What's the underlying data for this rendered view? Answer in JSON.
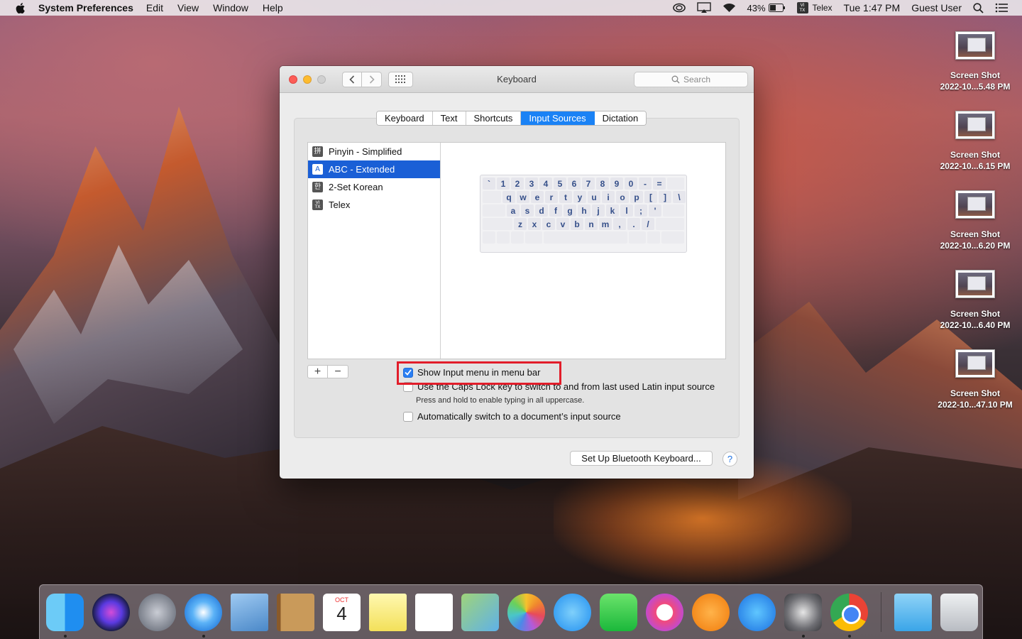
{
  "menubar": {
    "app_name": "System Preferences",
    "menus": [
      "Edit",
      "View",
      "Window",
      "Help"
    ],
    "battery": "43%",
    "input_source": "Telex",
    "clock": "Tue 1:47 PM",
    "user": "Guest User"
  },
  "desktop_icons": [
    {
      "line1": "Screen Shot",
      "line2": "2022-10...5.48 PM"
    },
    {
      "line1": "Screen Shot",
      "line2": "2022-10...6.15 PM"
    },
    {
      "line1": "Screen Shot",
      "line2": "2022-10...6.20 PM"
    },
    {
      "line1": "Screen Shot",
      "line2": "2022-10...6.40 PM"
    },
    {
      "line1": "Screen Shot",
      "line2": "2022-10...47.10 PM"
    }
  ],
  "window": {
    "title": "Keyboard",
    "search_placeholder": "Search",
    "tabs": [
      "Keyboard",
      "Text",
      "Shortcuts",
      "Input Sources",
      "Dictation"
    ],
    "active_tab": "Input Sources",
    "sources": [
      {
        "label": "Pinyin - Simplified",
        "icon": "拼"
      },
      {
        "label": "ABC - Extended",
        "icon": "A",
        "selected": true
      },
      {
        "label": "2-Set Korean",
        "icon": "한"
      },
      {
        "label": "Telex",
        "icon": "VI TX"
      }
    ],
    "keyboard_rows": [
      [
        "`",
        "1",
        "2",
        "3",
        "4",
        "5",
        "6",
        "7",
        "8",
        "9",
        "0",
        "-",
        "="
      ],
      [
        "q",
        "w",
        "e",
        "r",
        "t",
        "y",
        "u",
        "i",
        "o",
        "p",
        "[",
        "]",
        "\\"
      ],
      [
        "a",
        "s",
        "d",
        "f",
        "g",
        "h",
        "j",
        "k",
        "l",
        ";",
        "'"
      ],
      [
        "z",
        "x",
        "c",
        "v",
        "b",
        "n",
        "m",
        ",",
        ".",
        "/"
      ]
    ],
    "add_label": "+",
    "remove_label": "−",
    "option_show_menu": "Show Input menu in menu bar",
    "option_show_menu_checked": true,
    "option_caps_lock": "Use the Caps Lock key to switch to and from last used Latin input source",
    "option_caps_lock_checked": false,
    "option_caps_hint": "Press and hold to enable typing in all uppercase.",
    "option_auto_switch": "Automatically switch to a document’s input source",
    "option_auto_switch_checked": false,
    "bluetooth_button": "Set Up Bluetooth Keyboard...",
    "help_label": "?"
  },
  "dock": {
    "calendar_month": "OCT",
    "calendar_day": "4",
    "apps": [
      "finder",
      "siri",
      "launchpad",
      "safari",
      "mail",
      "contacts",
      "calendar",
      "notes",
      "reminders",
      "maps",
      "photos",
      "messages",
      "facetime",
      "itunes",
      "ibooks",
      "app-store",
      "system-preferences",
      "chrome",
      "downloads",
      "trash"
    ]
  },
  "colors": {
    "accent": "#1a82f5",
    "selection": "#1a5fd6",
    "highlight_box": "#e21d2a"
  }
}
